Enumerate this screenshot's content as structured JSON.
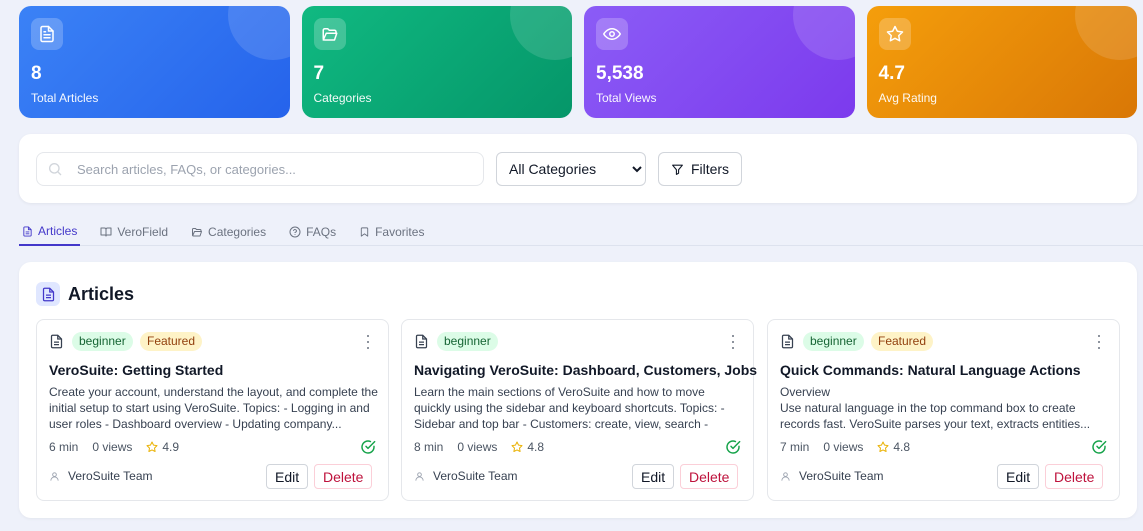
{
  "stats": [
    {
      "value": "8",
      "label": "Total Articles",
      "icon": "document-icon"
    },
    {
      "value": "7",
      "label": "Categories",
      "icon": "folder-open-icon"
    },
    {
      "value": "5,538",
      "label": "Total Views",
      "icon": "eye-icon"
    },
    {
      "value": "4.7",
      "label": "Avg Rating",
      "icon": "star-icon"
    }
  ],
  "search": {
    "placeholder": "Search articles, FAQs, or categories...",
    "category_selected": "All Categories",
    "filters_label": "Filters"
  },
  "tabs": [
    {
      "label": "Articles",
      "active": true
    },
    {
      "label": "VeroField"
    },
    {
      "label": "Categories"
    },
    {
      "label": "FAQs"
    },
    {
      "label": "Favorites"
    }
  ],
  "panel": {
    "title": "Articles"
  },
  "articles": [
    {
      "level": "beginner",
      "featured": "Featured",
      "title": "VeroSuite: Getting Started",
      "description": "Create your account, understand the layout, and complete the initial setup to start using VeroSuite. Topics: - Logging in and user roles - Dashboard overview - Updating company...",
      "read_time": "6 min",
      "views": "0 views",
      "rating": "4.9",
      "author": "VeroSuite Team",
      "edit_label": "Edit",
      "delete_label": "Delete"
    },
    {
      "level": "beginner",
      "title": "Navigating VeroSuite: Dashboard, Customers, Jobs",
      "description": "Learn the main sections of VeroSuite and how to move quickly using the sidebar and keyboard shortcuts. Topics: - Sidebar and top bar - Customers: create, view, search - Jobs:...",
      "read_time": "8 min",
      "views": "0 views",
      "rating": "4.8",
      "author": "VeroSuite Team",
      "edit_label": "Edit",
      "delete_label": "Delete"
    },
    {
      "level": "beginner",
      "featured": "Featured",
      "title": "Quick Commands: Natural Language Actions",
      "description": "Overview\nUse natural language in the top command box to create records fast. VeroSuite parses your text, extracts entities...",
      "read_time": "7 min",
      "views": "0 views",
      "rating": "4.8",
      "author": "VeroSuite Team",
      "edit_label": "Edit",
      "delete_label": "Delete"
    }
  ],
  "colors": {
    "accent": "#4338ca",
    "stat_blue": "#2563eb",
    "stat_green": "#059669",
    "stat_purple": "#7c3aed",
    "stat_orange": "#d97706",
    "featured": "#fef3c7",
    "beginner": "#dcfce7",
    "success": "#16a34a"
  }
}
